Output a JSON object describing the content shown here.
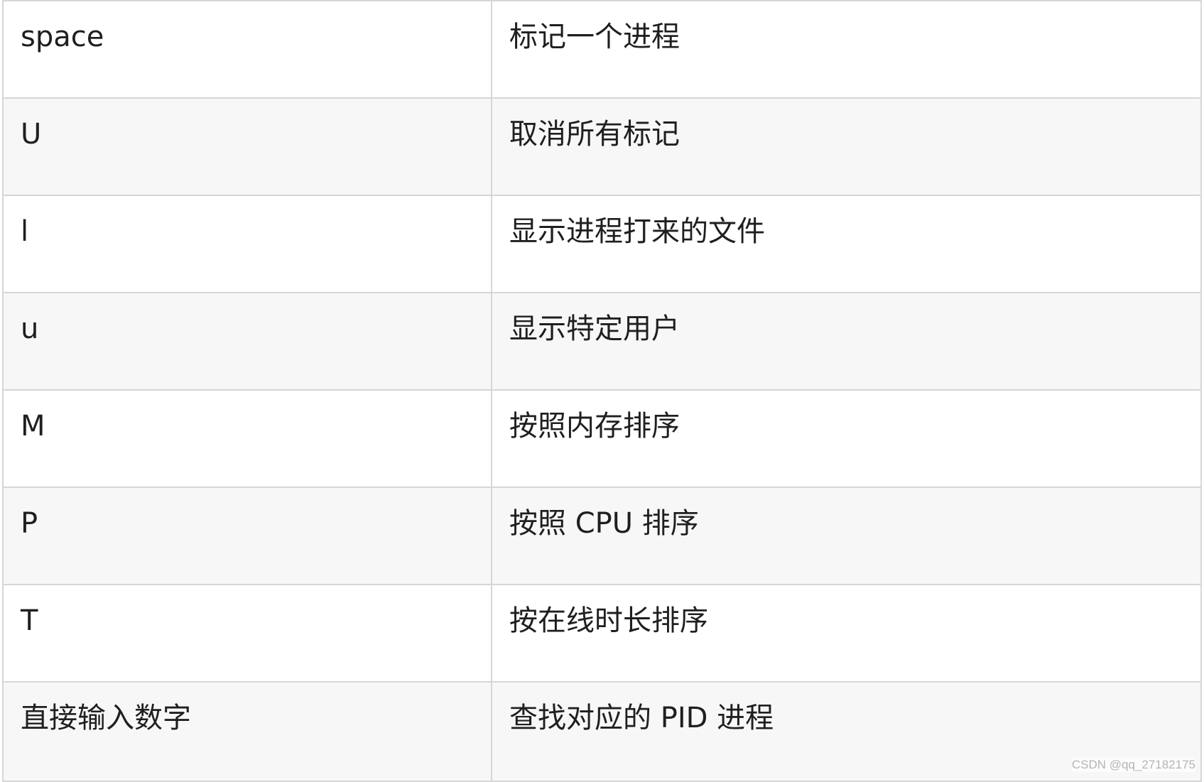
{
  "table": {
    "rows": [
      {
        "key": "space",
        "description": "标记一个进程"
      },
      {
        "key": "U",
        "description": "取消所有标记"
      },
      {
        "key": "l",
        "description": "显示进程打来的文件"
      },
      {
        "key": "u",
        "description": "显示特定用户"
      },
      {
        "key": "M",
        "description": "按照内存排序"
      },
      {
        "key": "P",
        "description": "按照 CPU 排序"
      },
      {
        "key": "T",
        "description": "按在线时长排序"
      },
      {
        "key": "直接输入数字",
        "description": "查找对应的 PID 进程"
      }
    ]
  },
  "watermark": "CSDN @qq_27182175",
  "colors": {
    "border": "#d6d6d6",
    "row_alt_background": "#f7f7f7",
    "text": "#1f1f1f",
    "watermark": "#b5b5b5"
  }
}
